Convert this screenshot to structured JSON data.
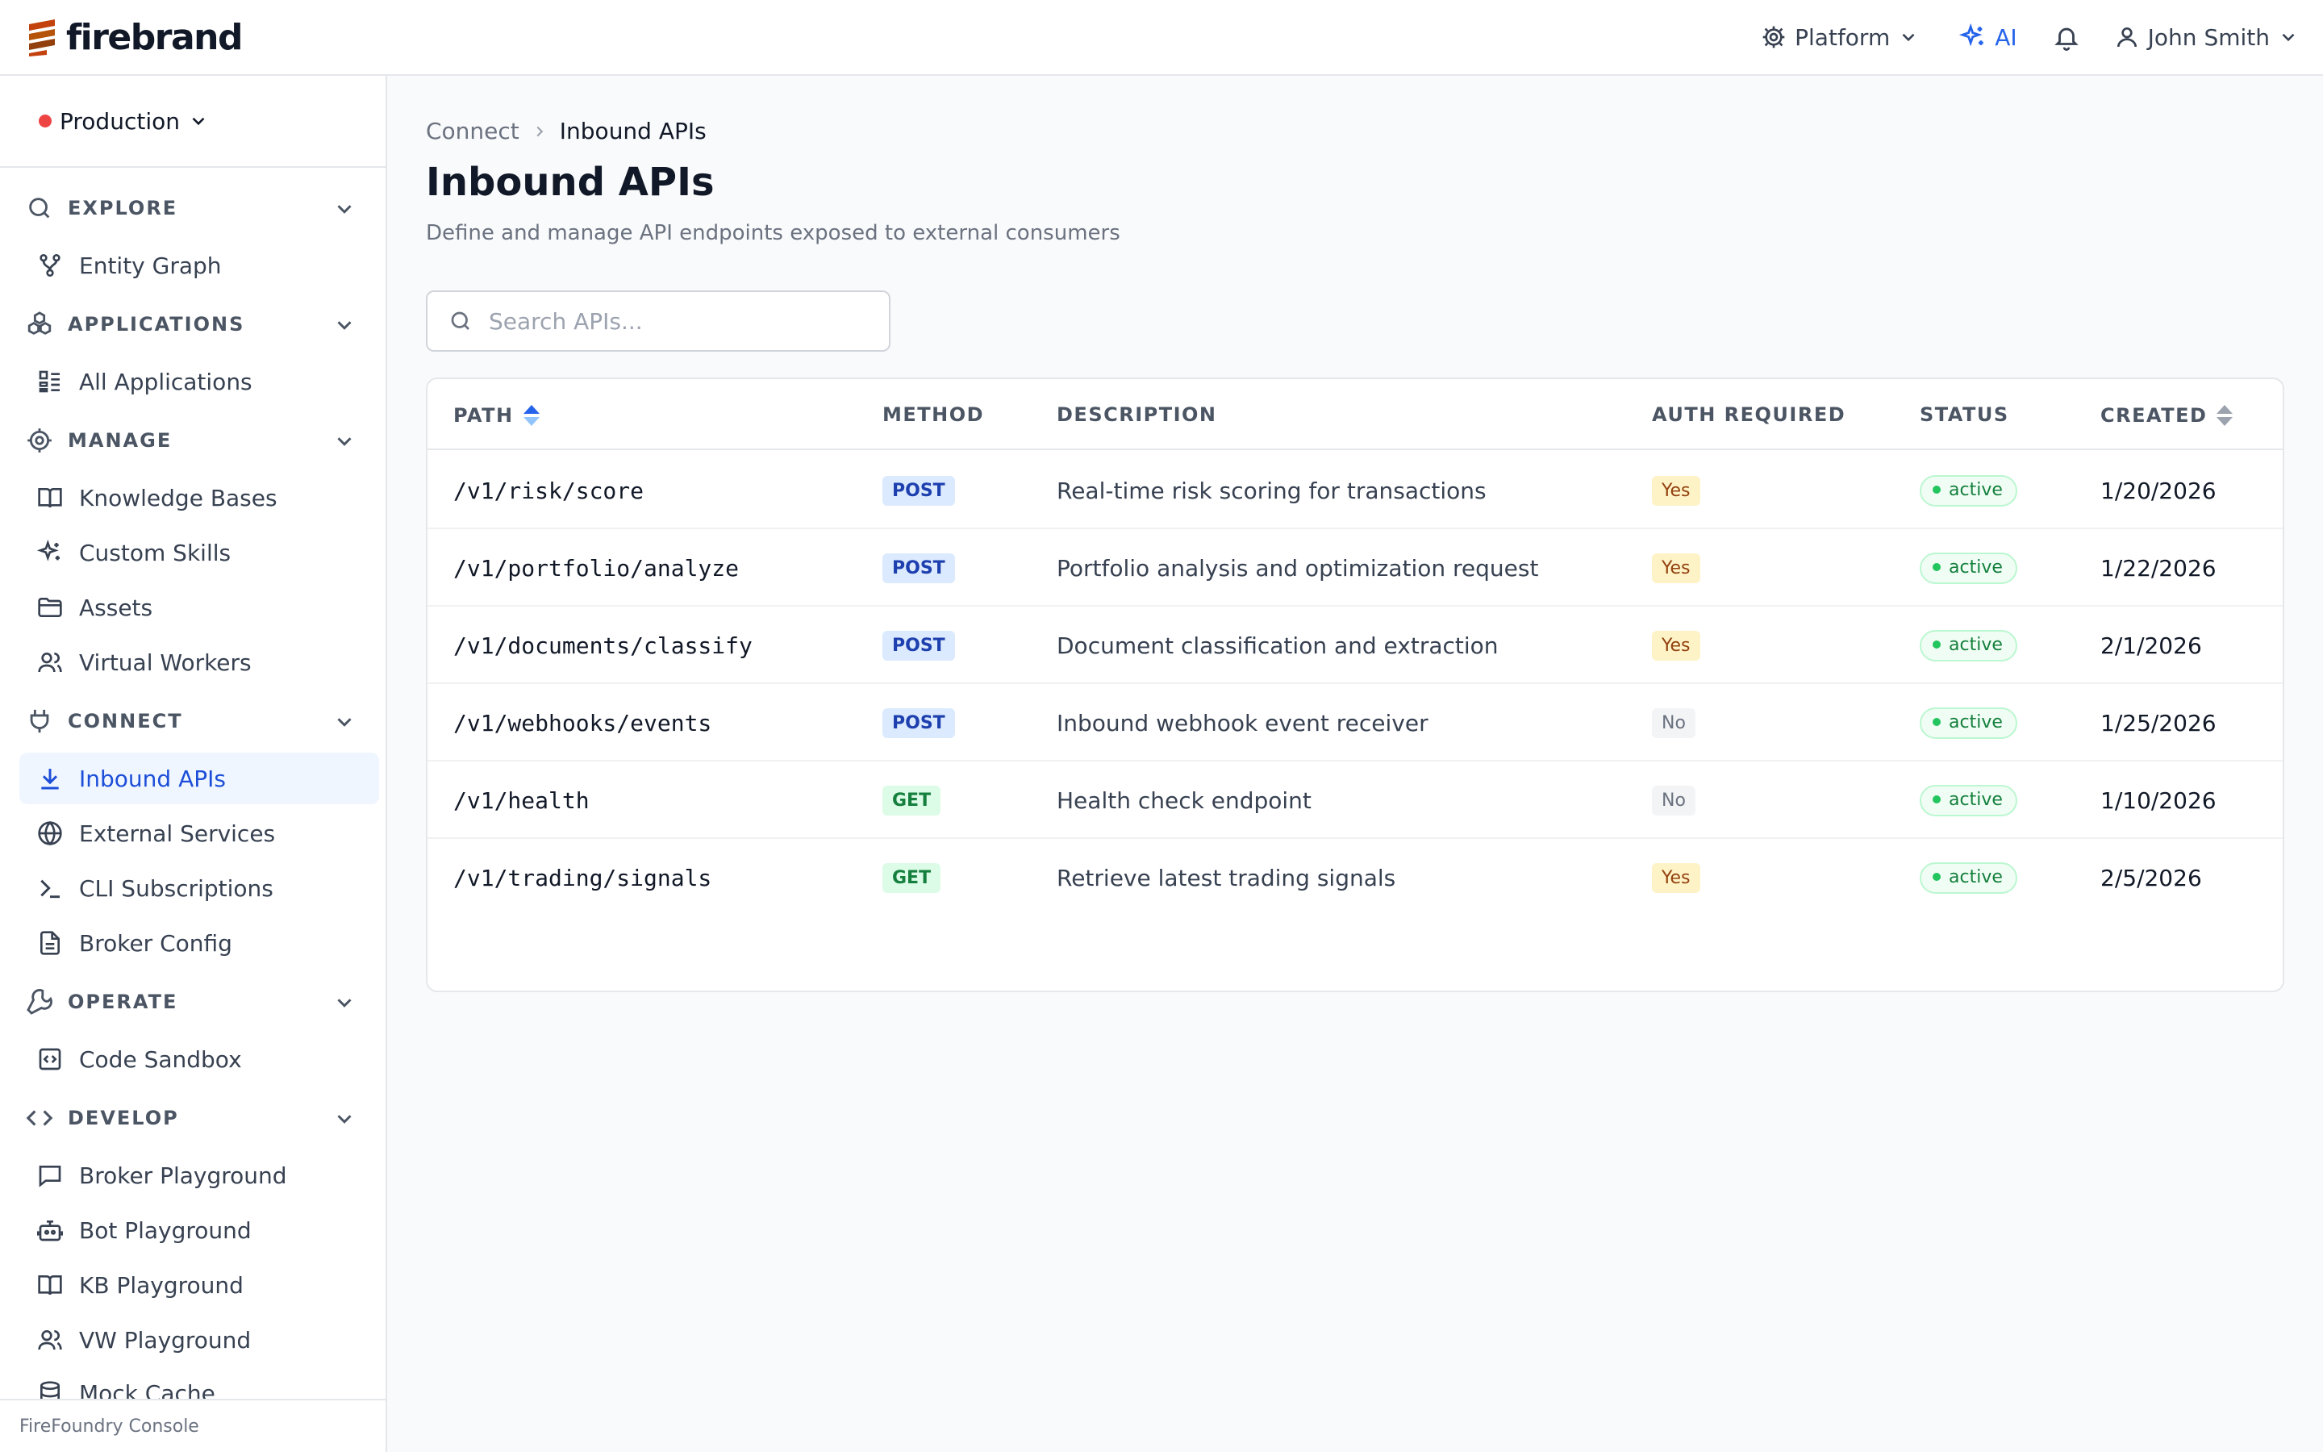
{
  "header": {
    "brand": "firebrand",
    "platform_label": "Platform",
    "ai_label": "AI",
    "user_name": "John Smith"
  },
  "sidebar": {
    "environment": "Production",
    "sections": [
      {
        "label": "EXPLORE",
        "icon": "search-icon",
        "items": [
          {
            "label": "Entity Graph",
            "icon": "graph-icon"
          }
        ]
      },
      {
        "label": "APPLICATIONS",
        "icon": "boxes-icon",
        "items": [
          {
            "label": "All Applications",
            "icon": "list-icon"
          }
        ]
      },
      {
        "label": "MANAGE",
        "icon": "gear-icon",
        "items": [
          {
            "label": "Knowledge Bases",
            "icon": "book-icon"
          },
          {
            "label": "Custom Skills",
            "icon": "sparkle-icon"
          },
          {
            "label": "Assets",
            "icon": "folder-icon"
          },
          {
            "label": "Virtual Workers",
            "icon": "users-icon"
          }
        ]
      },
      {
        "label": "CONNECT",
        "icon": "plug-icon",
        "items": [
          {
            "label": "Inbound APIs",
            "icon": "download-icon",
            "active": true
          },
          {
            "label": "External Services",
            "icon": "globe-icon"
          },
          {
            "label": "CLI Subscriptions",
            "icon": "terminal-icon"
          },
          {
            "label": "Broker Config",
            "icon": "file-icon"
          }
        ]
      },
      {
        "label": "OPERATE",
        "icon": "wrench-icon",
        "items": [
          {
            "label": "Code Sandbox",
            "icon": "code-box-icon"
          }
        ]
      },
      {
        "label": "DEVELOP",
        "icon": "code-icon",
        "items": [
          {
            "label": "Broker Playground",
            "icon": "chat-icon"
          },
          {
            "label": "Bot Playground",
            "icon": "bot-icon"
          },
          {
            "label": "KB Playground",
            "icon": "book-icon"
          },
          {
            "label": "VW Playground",
            "icon": "users-icon"
          },
          {
            "label": "Mock Cache",
            "icon": "database-icon"
          }
        ]
      }
    ],
    "footer": "FireFoundry Console"
  },
  "main": {
    "breadcrumb": [
      "Connect",
      "Inbound APIs"
    ],
    "title": "Inbound APIs",
    "subtitle": "Define and manage API endpoints exposed to external consumers",
    "search_placeholder": "Search APIs...",
    "search_value": "",
    "table": {
      "columns": [
        "PATH",
        "METHOD",
        "DESCRIPTION",
        "AUTH REQUIRED",
        "STATUS",
        "CREATED"
      ],
      "rows": [
        {
          "path": "/v1/risk/score",
          "method": "POST",
          "description": "Real-time risk scoring for transactions",
          "auth": "Yes",
          "status": "active",
          "created": "1/20/2026"
        },
        {
          "path": "/v1/portfolio/analyze",
          "method": "POST",
          "description": "Portfolio analysis and optimization request",
          "auth": "Yes",
          "status": "active",
          "created": "1/22/2026"
        },
        {
          "path": "/v1/documents/classify",
          "method": "POST",
          "description": "Document classification and extraction",
          "auth": "Yes",
          "status": "active",
          "created": "2/1/2026"
        },
        {
          "path": "/v1/webhooks/events",
          "method": "POST",
          "description": "Inbound webhook event receiver",
          "auth": "No",
          "status": "active",
          "created": "1/25/2026"
        },
        {
          "path": "/v1/health",
          "method": "GET",
          "description": "Health check endpoint",
          "auth": "No",
          "status": "active",
          "created": "1/10/2026"
        },
        {
          "path": "/v1/trading/signals",
          "method": "GET",
          "description": "Retrieve latest trading signals",
          "auth": "Yes",
          "status": "active",
          "created": "2/5/2026"
        }
      ]
    }
  },
  "colors": {
    "accent": "#2563eb",
    "brand": "#c2410c",
    "active_nav_bg": "#eff6ff",
    "status_active": "#15803d",
    "env_dot": "#ef4444"
  }
}
